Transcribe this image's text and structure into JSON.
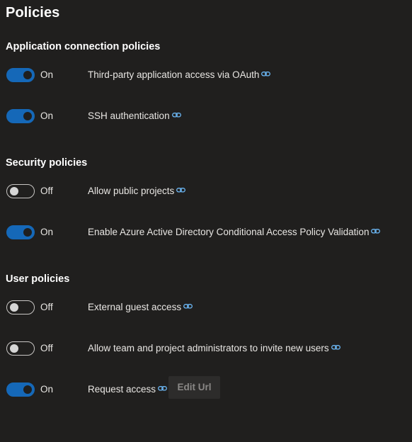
{
  "page": {
    "title": "Policies"
  },
  "sections": [
    {
      "title": "Application connection policies",
      "policies": [
        {
          "state": "On",
          "label": "Third-party application access via OAuth"
        },
        {
          "state": "On",
          "label": "SSH authentication"
        }
      ]
    },
    {
      "title": "Security policies",
      "policies": [
        {
          "state": "Off",
          "label": "Allow public projects"
        },
        {
          "state": "On",
          "label": "Enable Azure Active Directory Conditional Access Policy Validation"
        }
      ]
    },
    {
      "title": "User policies",
      "policies": [
        {
          "state": "Off",
          "label": "External guest access"
        },
        {
          "state": "Off",
          "label": "Allow team and project administrators to invite new users"
        },
        {
          "state": "On",
          "label": "Request access",
          "button": "Edit Url"
        }
      ]
    }
  ],
  "icons": {
    "link": "link-icon"
  },
  "colors": {
    "background": "#201f1e",
    "toggle_on": "#1568b8",
    "link_icon": "#6cb8f6"
  }
}
